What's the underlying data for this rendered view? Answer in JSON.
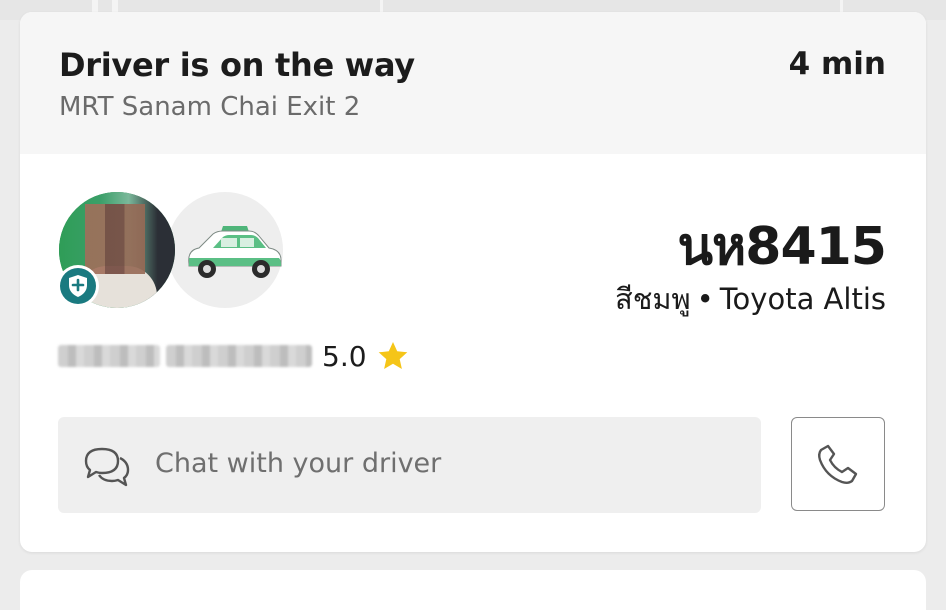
{
  "status": {
    "title": "Driver is on the way",
    "eta": "4 min",
    "pickup": "MRT Sanam Chai Exit 2"
  },
  "driver": {
    "rating": "5.0",
    "verified_icon": "shield-plus-icon",
    "photo_blurred": true,
    "name_blurred": true
  },
  "vehicle": {
    "plate": "นห8415",
    "color": "สีชมพู",
    "separator": "•",
    "model": "Toyota Altis",
    "icon": "taxi-car-icon"
  },
  "actions": {
    "chat_placeholder": "Chat with your driver",
    "chat_icon": "chat-bubbles-icon",
    "call_icon": "phone-icon"
  },
  "colors": {
    "badge": "#1a7a80",
    "star": "#f5c518",
    "taxi_green": "#5bbf85"
  }
}
